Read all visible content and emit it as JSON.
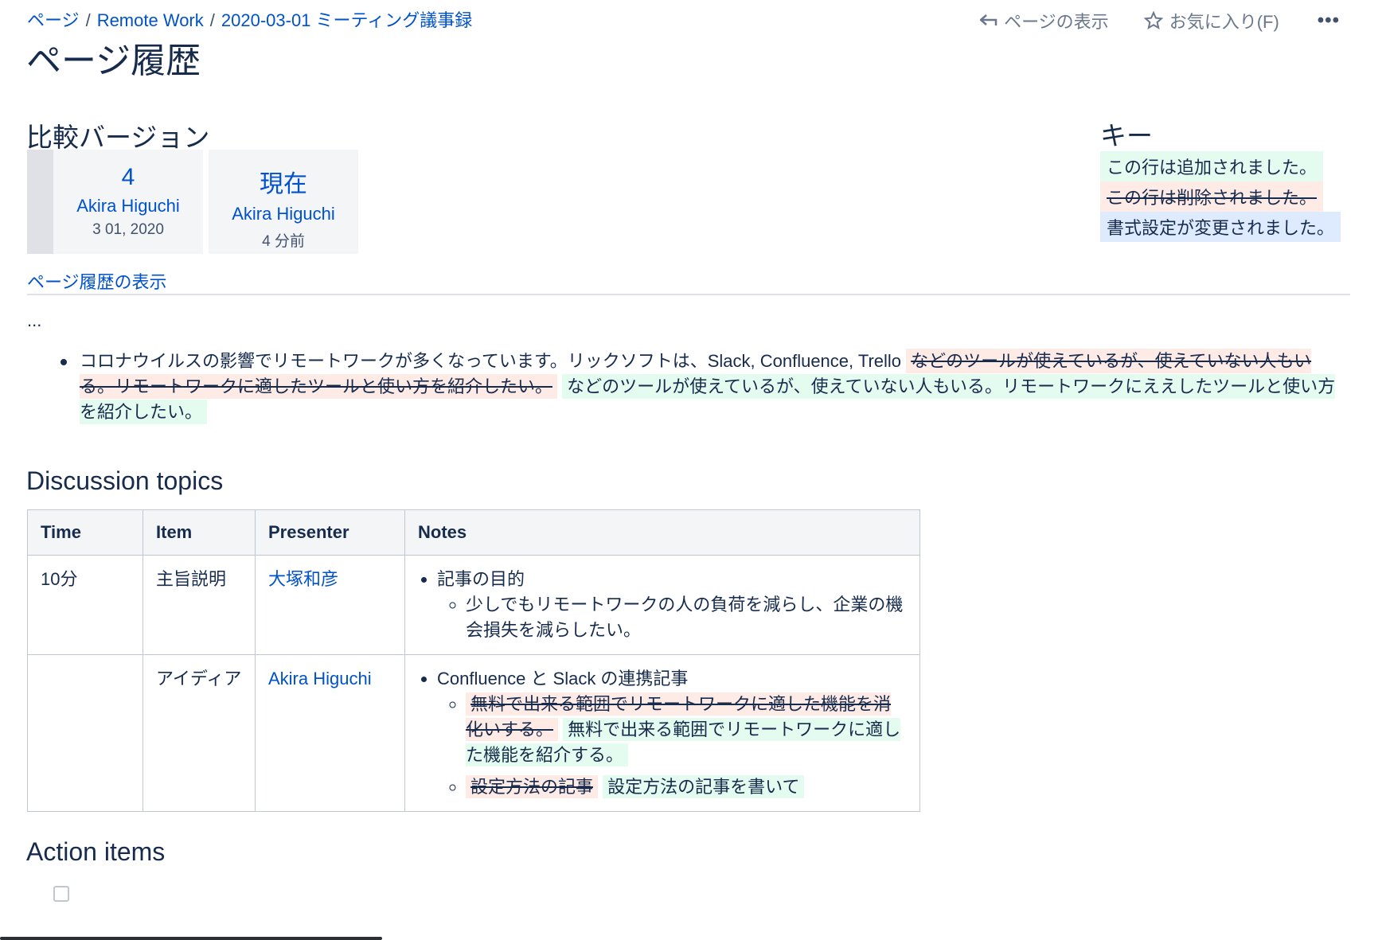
{
  "breadcrumb": [
    "ページ",
    "Remote Work",
    "2020-03-01 ミーティング議事録"
  ],
  "page_title": "ページ履歴",
  "actions": {
    "view_page": "ページの表示",
    "favorite": "お気に入り(F)",
    "more": "•••"
  },
  "compare": {
    "heading": "比較バージョン",
    "versions": [
      {
        "number": "4",
        "author": "Akira Higuchi",
        "date": "3 01, 2020"
      },
      {
        "number": "現在",
        "author": "Akira Higuchi",
        "date": "4 分前"
      }
    ]
  },
  "key": {
    "heading": "キー",
    "added": "この行は追加されました。",
    "deleted": "この行は削除されました。",
    "changed": "書式設定が変更されました。"
  },
  "history_link": "ページ履歴の表示",
  "ellipsis": "...",
  "paragraph": {
    "text": "コロナウイルスの影響でリモートワークが多くなっています。リックソフトは、Slack, Confluence, Trello",
    "deleted": "などのツールが使えているが、使えていない人もいる。リモートワークに適したツールと使い方を紹介したい。",
    "inserted": "などのツールが使えているが、使えていない人もいる。リモートワークにええしたツールと使い方を紹介したい。"
  },
  "discussion": {
    "heading": "Discussion topics",
    "columns": [
      "Time",
      "Item",
      "Presenter",
      "Notes"
    ],
    "rows": [
      {
        "time": "10分",
        "item": "主旨説明",
        "presenter": "大塚和彦",
        "note_main": "記事の目的",
        "note_sub": "少しでもリモートワークの人の負荷を減らし、企業の機会損失を減らしたい。"
      },
      {
        "time": "",
        "item": "アイディア",
        "presenter": "Akira Higuchi",
        "note_main": "Confluence と Slack の連携記事",
        "sub1_deleted": "無料で出来る範囲でリモートワークに適した機能を消化いする。",
        "sub1_inserted": "無料で出来る範囲でリモートワークに適した機能を紹介する。",
        "sub2_deleted": "設定方法の記事",
        "sub2_inserted": "設定方法の記事を書いて"
      }
    ]
  },
  "action_items": {
    "heading": "Action items",
    "checked": false
  }
}
